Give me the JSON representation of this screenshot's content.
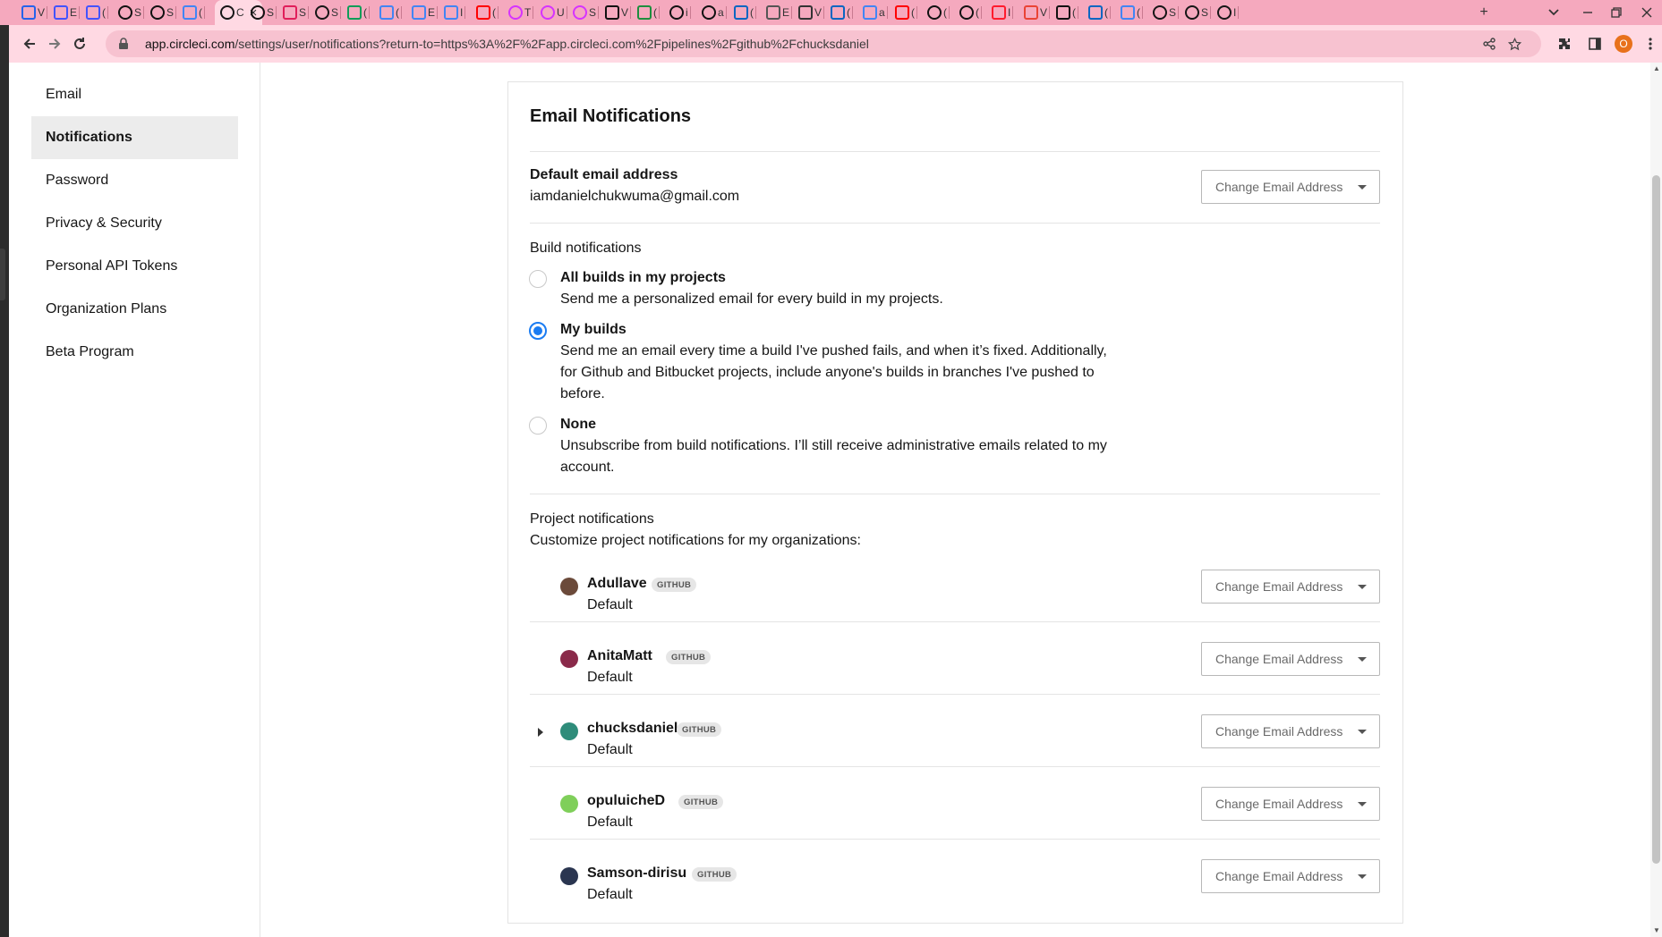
{
  "browser": {
    "tabs": [
      {
        "icon": "vercel-icon",
        "color": "#2563eb",
        "label": "V"
      },
      {
        "icon": "webflow-icon",
        "color": "#4353ff",
        "label": "E"
      },
      {
        "icon": "webflow-icon",
        "color": "#4353ff",
        "label": "("
      },
      {
        "icon": "github-icon",
        "color": "#111111",
        "label": "S"
      },
      {
        "icon": "github-icon",
        "color": "#111111",
        "label": "S"
      },
      {
        "icon": "docs-icon",
        "color": "#4285f4",
        "label": "("
      },
      {
        "icon": "circleci-icon",
        "color": "#161616",
        "label": "C",
        "active": true
      },
      {
        "icon": "github-icon",
        "color": "#111111",
        "label": "S"
      },
      {
        "icon": "slack-icon",
        "color": "#e01e5a",
        "label": "S"
      },
      {
        "icon": "circleci-icon",
        "color": "#161616",
        "label": "S"
      },
      {
        "icon": "drive-icon",
        "color": "#0f9d58",
        "label": "("
      },
      {
        "icon": "docs-icon",
        "color": "#4285f4",
        "label": "("
      },
      {
        "icon": "docs-icon",
        "color": "#4285f4",
        "label": "E"
      },
      {
        "icon": "docs-icon",
        "color": "#4285f4",
        "label": "I"
      },
      {
        "icon": "youtube-icon",
        "color": "#ff0000",
        "label": "("
      },
      {
        "icon": "circle-icon",
        "color": "#d633ff",
        "label": "T"
      },
      {
        "icon": "circle-icon",
        "color": "#d633ff",
        "label": "U"
      },
      {
        "icon": "circle-icon",
        "color": "#d633ff",
        "label": "S"
      },
      {
        "icon": "medium-icon",
        "color": "#111111",
        "label": "V"
      },
      {
        "icon": "sheet-icon",
        "color": "#1e8e3e",
        "label": "("
      },
      {
        "icon": "github-icon",
        "color": "#111111",
        "label": "i"
      },
      {
        "icon": "github-icon",
        "color": "#111111",
        "label": "a"
      },
      {
        "icon": "linkedin-icon",
        "color": "#0a66c2",
        "label": "("
      },
      {
        "icon": "link-icon",
        "color": "#555555",
        "label": "E"
      },
      {
        "icon": "wikipedia-icon",
        "color": "#333333",
        "label": "V"
      },
      {
        "icon": "linkedin-icon",
        "color": "#0a66c2",
        "label": "("
      },
      {
        "icon": "google-icon",
        "color": "#4285f4",
        "label": "a"
      },
      {
        "icon": "youtube-icon",
        "color": "#ff0000",
        "label": "("
      },
      {
        "icon": "github-icon",
        "color": "#111111",
        "label": "("
      },
      {
        "icon": "github-icon",
        "color": "#111111",
        "label": "("
      },
      {
        "icon": "opera-icon",
        "color": "#ff1b2d",
        "label": "I"
      },
      {
        "icon": "gmail-icon",
        "color": "#ea4335",
        "label": "V"
      },
      {
        "icon": "medium-icon",
        "color": "#111111",
        "label": "("
      },
      {
        "icon": "linkedin-icon",
        "color": "#0a66c2",
        "label": "("
      },
      {
        "icon": "google-icon",
        "color": "#4285f4",
        "label": "("
      },
      {
        "icon": "circleci-icon",
        "color": "#161616",
        "label": "S"
      },
      {
        "icon": "circleci-icon",
        "color": "#161616",
        "label": "S"
      },
      {
        "icon": "circleci-icon",
        "color": "#161616",
        "label": "I"
      }
    ],
    "url_host": "app.circleci.com",
    "url_rest": "/settings/user/notifications?return-to=https%3A%2F%2Fapp.circleci.com%2Fpipelines%2Fgithub%2Fchucksdaniel",
    "profile_initial": "O",
    "new_tab_symbol": "+",
    "accent": "#f5a9be"
  },
  "sidebar": {
    "items": [
      {
        "label": "Email",
        "active": false
      },
      {
        "label": "Notifications",
        "active": true
      },
      {
        "label": "Password",
        "active": false
      },
      {
        "label": "Privacy & Security",
        "active": false
      },
      {
        "label": "Personal API Tokens",
        "active": false
      },
      {
        "label": "Organization Plans",
        "active": false
      },
      {
        "label": "Beta Program",
        "active": false
      }
    ]
  },
  "main": {
    "title": "Email Notifications",
    "default_email": {
      "label": "Default email address",
      "value": "iamdanielchukwuma@gmail.com",
      "button": "Change Email Address"
    },
    "build": {
      "heading": "Build notifications",
      "options": [
        {
          "title": "All builds in my projects",
          "description": "Send me a personalized email for every build in my projects.",
          "checked": false
        },
        {
          "title": "My builds",
          "description": "Send me an email every time a build I've pushed fails, and when it’s fixed. Additionally, for Github and Bitbucket projects, include anyone's builds in branches I've pushed to before.",
          "checked": true
        },
        {
          "title": "None",
          "description": "Unsubscribe from build notifications. I’ll still receive administrative emails related to my account.",
          "checked": false
        }
      ],
      "accent": "#1b7cf2"
    },
    "projects": {
      "heading": "Project notifications",
      "subheading": "Customize project notifications for my organizations:",
      "orgs": [
        {
          "name": "Adullave",
          "badge": "GITHUB",
          "value": "Default",
          "button": "Change Email Address",
          "avatar_color": "#6b4a3a",
          "expandable": false
        },
        {
          "name": "AnitaMatt",
          "badge": "GITHUB",
          "value": "Default",
          "button": "Change Email Address",
          "avatar_color": "#8a2a4a",
          "expandable": false
        },
        {
          "name": "chucksdaniel",
          "badge": "GITHUB",
          "value": "Default",
          "button": "Change Email Address",
          "avatar_color": "#2e8c7a",
          "expandable": true
        },
        {
          "name": "opuluicheD",
          "badge": "GITHUB",
          "value": "Default",
          "button": "Change Email Address",
          "avatar_color": "#7fcf5a",
          "expandable": false
        },
        {
          "name": "Samson-dirisu",
          "badge": "GITHUB",
          "value": "Default",
          "button": "Change Email Address",
          "avatar_color": "#2a3550",
          "expandable": false
        }
      ]
    }
  }
}
